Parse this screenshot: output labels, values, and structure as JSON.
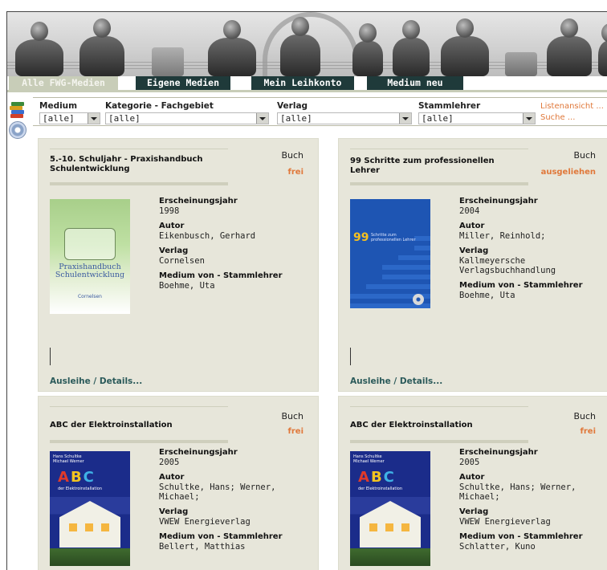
{
  "nav": {
    "tabs": [
      {
        "label": "Alle FWG-Medien",
        "active": true
      },
      {
        "label": "Eigene Medien",
        "active": false
      },
      {
        "label": "Mein Leihkonto",
        "active": false
      },
      {
        "label": "Medium neu",
        "active": false
      }
    ]
  },
  "filters": {
    "medium": {
      "label": "Medium",
      "value": "[alle]"
    },
    "kategorie": {
      "label": "Kategorie - Fachgebiet",
      "value": "[alle]"
    },
    "verlag": {
      "label": "Verlag",
      "value": "[alle]"
    },
    "stammlehrer": {
      "label": "Stammlehrer",
      "value": "[alle]"
    },
    "list_view_link": "Listenansicht ...",
    "search_link": "Suche ..."
  },
  "field_labels": {
    "year": "Erscheinungsjahr",
    "author": "Autor",
    "publisher": "Verlag",
    "owner": "Medium von - Stammlehrer",
    "details_link": "Ausleihe / Details..."
  },
  "cards": [
    {
      "title": "5.-10. Schuljahr - Praxishandbuch Schulentwicklung",
      "type": "Buch",
      "status": "frei",
      "year": "1998",
      "author": "Eikenbusch, Gerhard",
      "publisher": "Cornelsen",
      "owner": "Boehme, Uta",
      "cover": {
        "lines": [
          "Praxishandbuch",
          "Schulentwicklung"
        ],
        "publisher": "Cornelsen"
      }
    },
    {
      "title": "99 Schritte zum professionellen Lehrer",
      "type": "Buch",
      "status": "ausgeliehen",
      "year": "2004",
      "author": "Miller, Reinhold;",
      "publisher": "Kallmeyersche Verlagsbuchhandlung",
      "owner": "Boehme, Uta",
      "cover": {
        "number": "99",
        "subtitle": "Schritte zum professionellen Lehrer"
      }
    },
    {
      "title": "ABC der Elektroinstallation",
      "type": "Buch",
      "status": "frei",
      "year": "2005",
      "author": "Schultke, Hans; Werner, Michael;",
      "publisher": "VWEW Energieverlag",
      "owner": "Bellert, Matthias",
      "cover": {
        "authors": [
          "Hans Schultke",
          "Michael Werner"
        ],
        "subtitle": "der Elektroinstallation"
      }
    },
    {
      "title": "ABC der Elektroinstallation",
      "type": "Buch",
      "status": "frei",
      "year": "2005",
      "author": "Schultke, Hans; Werner, Michael;",
      "publisher": "VWEW Energieverlag",
      "owner": "Schlatter, Kuno",
      "cover": {
        "authors": [
          "Hans Schultke",
          "Michael Werner"
        ],
        "subtitle": "der Elektroinstallation"
      }
    }
  ],
  "colors": {
    "tab_dark": "#1f3a3a",
    "tab_active": "#c8cdb8",
    "card_bg": "#e7e6da",
    "status_orange": "#e0783a",
    "link_teal": "#2b5a5a"
  }
}
